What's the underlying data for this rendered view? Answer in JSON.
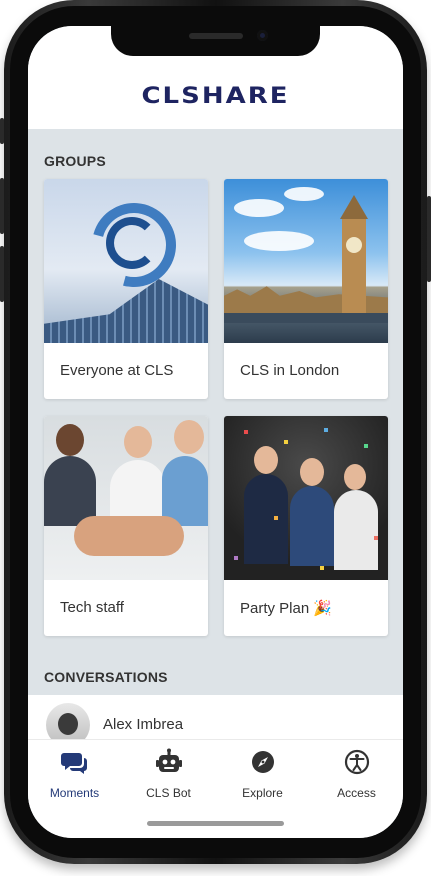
{
  "app": {
    "logo_text": "CLSHARE",
    "brand_color": "#1e2461",
    "accent_color": "#243a78",
    "background_color": "#dde3e7"
  },
  "groups": {
    "title": "GROUPS",
    "items": [
      {
        "label": "Everyone at CLS"
      },
      {
        "label": "CLS in London"
      },
      {
        "label": "Tech staff"
      },
      {
        "label": "Party Plan 🎉"
      }
    ]
  },
  "conversations": {
    "title": "CONVERSATIONS",
    "items": [
      {
        "name": "Alex Imbrea"
      }
    ]
  },
  "tabbar": {
    "items": [
      {
        "label": "Moments",
        "icon": "chat-bubbles-icon",
        "active": true
      },
      {
        "label": "CLS Bot",
        "icon": "robot-icon",
        "active": false
      },
      {
        "label": "Explore",
        "icon": "compass-icon",
        "active": false
      },
      {
        "label": "Access",
        "icon": "accessibility-icon",
        "active": false
      }
    ]
  }
}
